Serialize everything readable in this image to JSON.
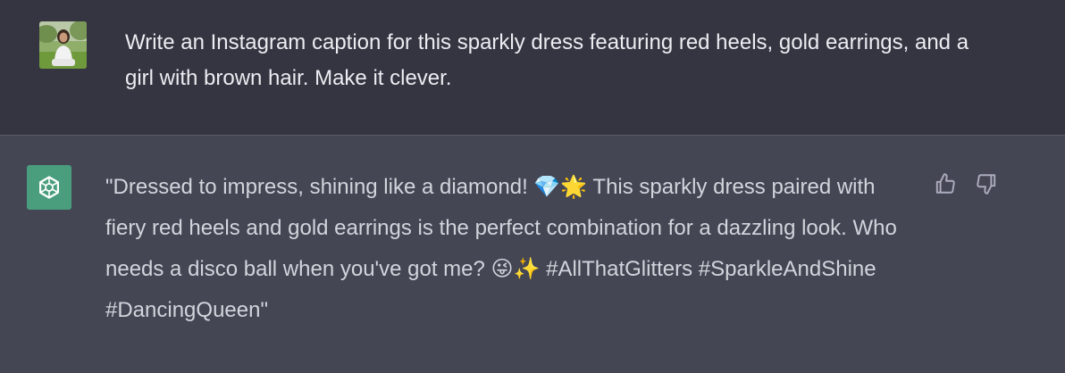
{
  "user_message": {
    "text": "Write an Instagram caption for this sparkly dress featuring red heels, gold earrings, and a girl with brown hair. Make it clever."
  },
  "assistant_message": {
    "text": "\"Dressed to impress, shining like a diamond! 💎🌟 This sparkly dress paired with fiery red heels and gold earrings is the perfect combination for a dazzling look. Who needs a disco ball when you've got me? 😜✨ #AllThatGlitters #SparkleAndShine #DancingQueen\""
  },
  "icons": {
    "user_avatar": "user-photo-avatar",
    "assistant_avatar": "openai-logo-icon",
    "thumbs_up": "thumbs-up-icon",
    "thumbs_down": "thumbs-down-icon"
  },
  "colors": {
    "user_bg": "#343541",
    "assistant_bg": "#444654",
    "assistant_avatar_bg": "#4a9e7e",
    "text_primary": "#ececf1",
    "text_secondary": "#d1d5db",
    "icon_color": "#acacbe"
  }
}
